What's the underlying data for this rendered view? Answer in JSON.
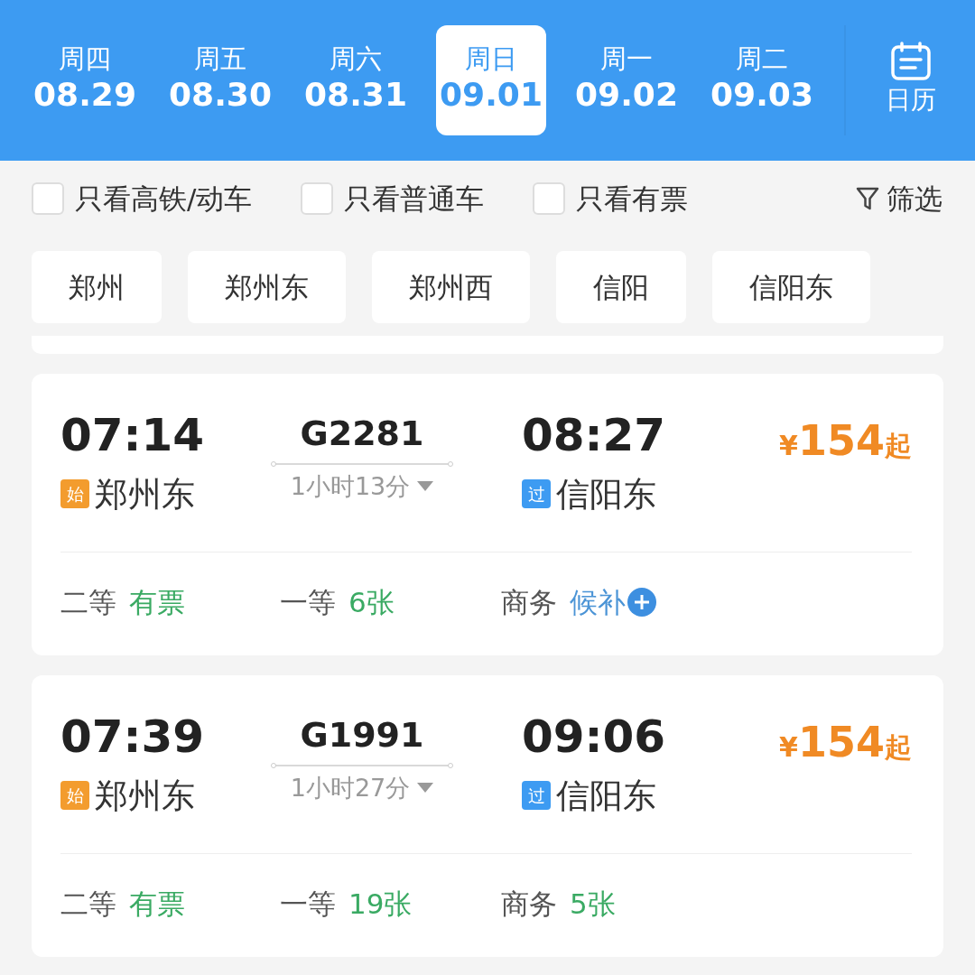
{
  "dates": [
    {
      "weekday": "周四",
      "date": "08.29",
      "selected": false
    },
    {
      "weekday": "周五",
      "date": "08.30",
      "selected": false
    },
    {
      "weekday": "周六",
      "date": "08.31",
      "selected": false
    },
    {
      "weekday": "周日",
      "date": "09.01",
      "selected": true
    },
    {
      "weekday": "周一",
      "date": "09.02",
      "selected": false
    },
    {
      "weekday": "周二",
      "date": "09.03",
      "selected": false
    }
  ],
  "calendar": {
    "label": "日历"
  },
  "filters": [
    {
      "label": "只看高铁/动车",
      "checked": false
    },
    {
      "label": "只看普通车",
      "checked": false
    },
    {
      "label": "只看有票",
      "checked": false
    }
  ],
  "filter_button": {
    "label": "筛选"
  },
  "stations": [
    {
      "label": "郑州"
    },
    {
      "label": "郑州东"
    },
    {
      "label": "郑州西"
    },
    {
      "label": "信阳"
    },
    {
      "label": "信阳东"
    }
  ],
  "trains": [
    {
      "depart_time": "07:14",
      "train_no": "G2281",
      "arrive_time": "08:27",
      "price_symbol": "¥",
      "price": "154",
      "price_suffix": "起",
      "depart_tag": {
        "text": "始",
        "kind": "origin"
      },
      "depart_station": "郑州东",
      "duration": "1小时13分",
      "arrive_tag": {
        "text": "过",
        "kind": "pass"
      },
      "arrive_station": "信阳东",
      "seats": [
        {
          "class": "二等",
          "status": "有票",
          "kind": "available"
        },
        {
          "class": "一等",
          "status": "6张",
          "kind": "available"
        },
        {
          "class": "商务",
          "status": "候补",
          "kind": "waitlist"
        }
      ]
    },
    {
      "depart_time": "07:39",
      "train_no": "G1991",
      "arrive_time": "09:06",
      "price_symbol": "¥",
      "price": "154",
      "price_suffix": "起",
      "depart_tag": {
        "text": "始",
        "kind": "origin"
      },
      "depart_station": "郑州东",
      "duration": "1小时27分",
      "arrive_tag": {
        "text": "过",
        "kind": "pass"
      },
      "arrive_station": "信阳东",
      "seats": [
        {
          "class": "二等",
          "status": "有票",
          "kind": "available"
        },
        {
          "class": "一等",
          "status": "19张",
          "kind": "available"
        },
        {
          "class": "商务",
          "status": "5张",
          "kind": "available"
        }
      ]
    }
  ]
}
